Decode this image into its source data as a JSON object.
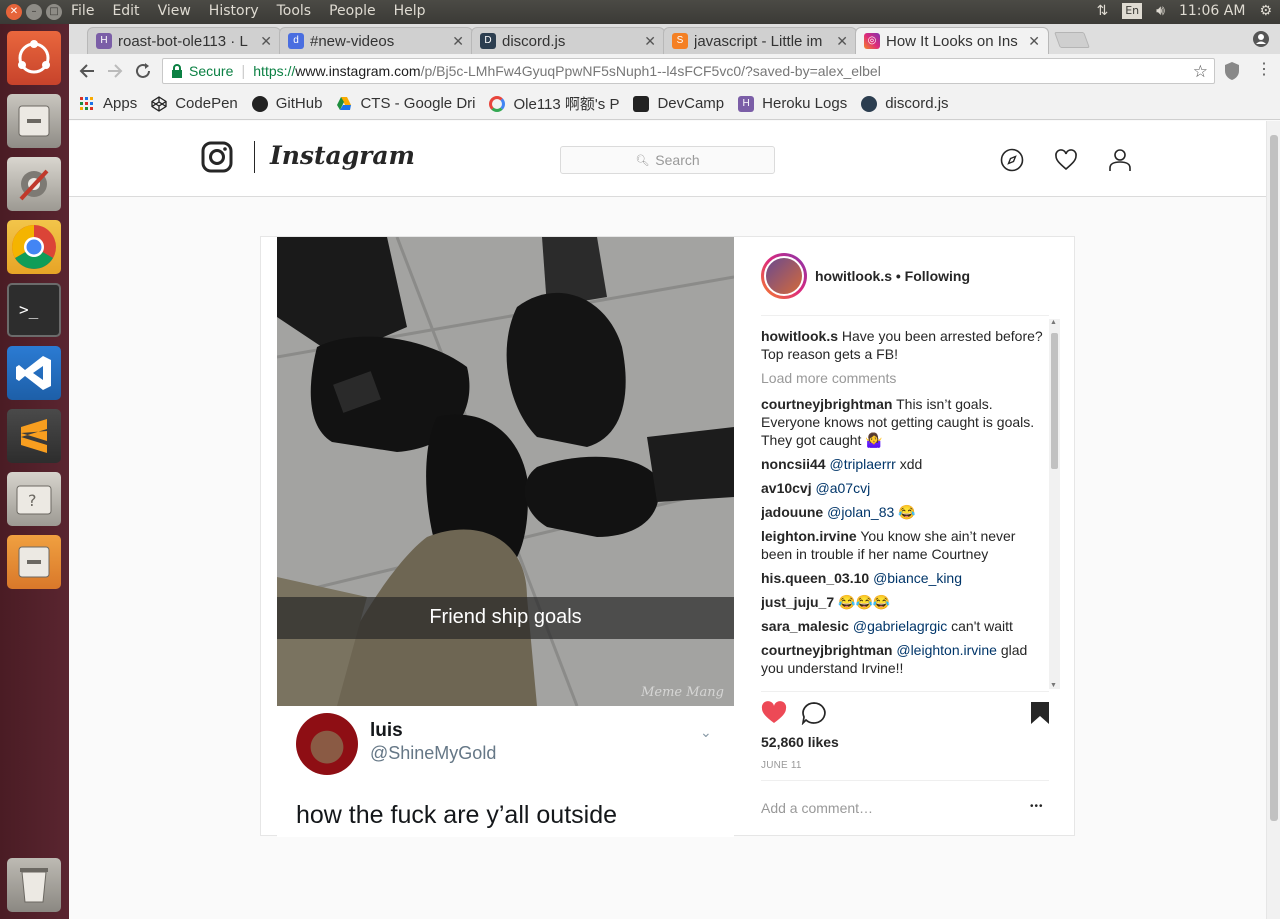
{
  "os": {
    "menu": [
      "File",
      "Edit",
      "View",
      "History",
      "Tools",
      "People",
      "Help"
    ],
    "tray": {
      "keyboard": "En",
      "clock": "11:06 AM"
    }
  },
  "browser": {
    "tabs": [
      {
        "title": "roast-bot-ole113 · L",
        "favicon": "heroku-icon",
        "color": "#7b5ea7"
      },
      {
        "title": "#new-videos",
        "favicon": "discord-icon",
        "color": "#4a6ee0"
      },
      {
        "title": "discord.js",
        "favicon": "discordjs-icon",
        "color": "#2c3e50"
      },
      {
        "title": "javascript - Little im",
        "favicon": "stackoverflow-icon",
        "color": "#f48024"
      },
      {
        "title": "How It Looks on Ins",
        "favicon": "instagram-icon",
        "color": "#c13584"
      }
    ],
    "url": {
      "secure_label": "Secure",
      "scheme": "https://",
      "host": "www.instagram.com",
      "path": "/p/Bj5c-LMhFw4GyuqPpwNF5sNuph1--l4sFCF5vc0/?saved-by=alex_elbel"
    },
    "bookmarks": [
      {
        "label": "Apps",
        "icon": "apps-grid-icon"
      },
      {
        "label": "CodePen",
        "icon": "codepen-icon"
      },
      {
        "label": "GitHub",
        "icon": "github-icon"
      },
      {
        "label": "CTS - Google Dri",
        "icon": "google-drive-icon"
      },
      {
        "label": "Ole113 啊额's P",
        "icon": "chrome-web-icon"
      },
      {
        "label": "DevCamp",
        "icon": "devcamp-icon"
      },
      {
        "label": "Heroku Logs",
        "icon": "heroku-icon"
      },
      {
        "label": "discord.js",
        "icon": "discordjs-icon"
      }
    ]
  },
  "instagram": {
    "wordmark": "Instagram",
    "search_placeholder": "Search",
    "post": {
      "username": "howitlook.s",
      "follow_status": "• Following",
      "caption": "Have you been arrested before? Top reason gets a FB!",
      "load_more": "Load more comments",
      "comments": [
        {
          "user": "courtneyjbrightman",
          "mention": "",
          "text": "This isn’t goals. Everyone knows not getting caught is goals. They got caught 🤷‍♀"
        },
        {
          "user": "noncsii44",
          "mention": "@triplaerrr",
          "text": "xdd"
        },
        {
          "user": "av10cvj",
          "mention": "@a07cvj",
          "text": ""
        },
        {
          "user": "jadouune",
          "mention": "@jolan_83",
          "text": "😂"
        },
        {
          "user": "leighton.irvine",
          "mention": "",
          "text": "You know she ain’t never been in trouble if her name Courtney"
        },
        {
          "user": "his.queen_03.10",
          "mention": "@biance_king",
          "text": ""
        },
        {
          "user": "just_juju_7",
          "mention": "",
          "text": "😂😂😂"
        },
        {
          "user": "sara_malesic",
          "mention": "@gabrielagrgic",
          "text": "can't waitt"
        },
        {
          "user": "courtneyjbrightman",
          "mention": "@leighton.irvine",
          "text": "glad you understand Irvine!!"
        }
      ],
      "likes": "52,860 likes",
      "date": "JUNE 11",
      "add_comment_placeholder": "Add a comment…",
      "more": "•••",
      "image_caption": "Friend ship goals",
      "watermark": "Meme Mang",
      "tweet": {
        "name": "luis",
        "handle": "@ShineMyGold",
        "text": "how the fuck are y’all outside"
      }
    }
  }
}
